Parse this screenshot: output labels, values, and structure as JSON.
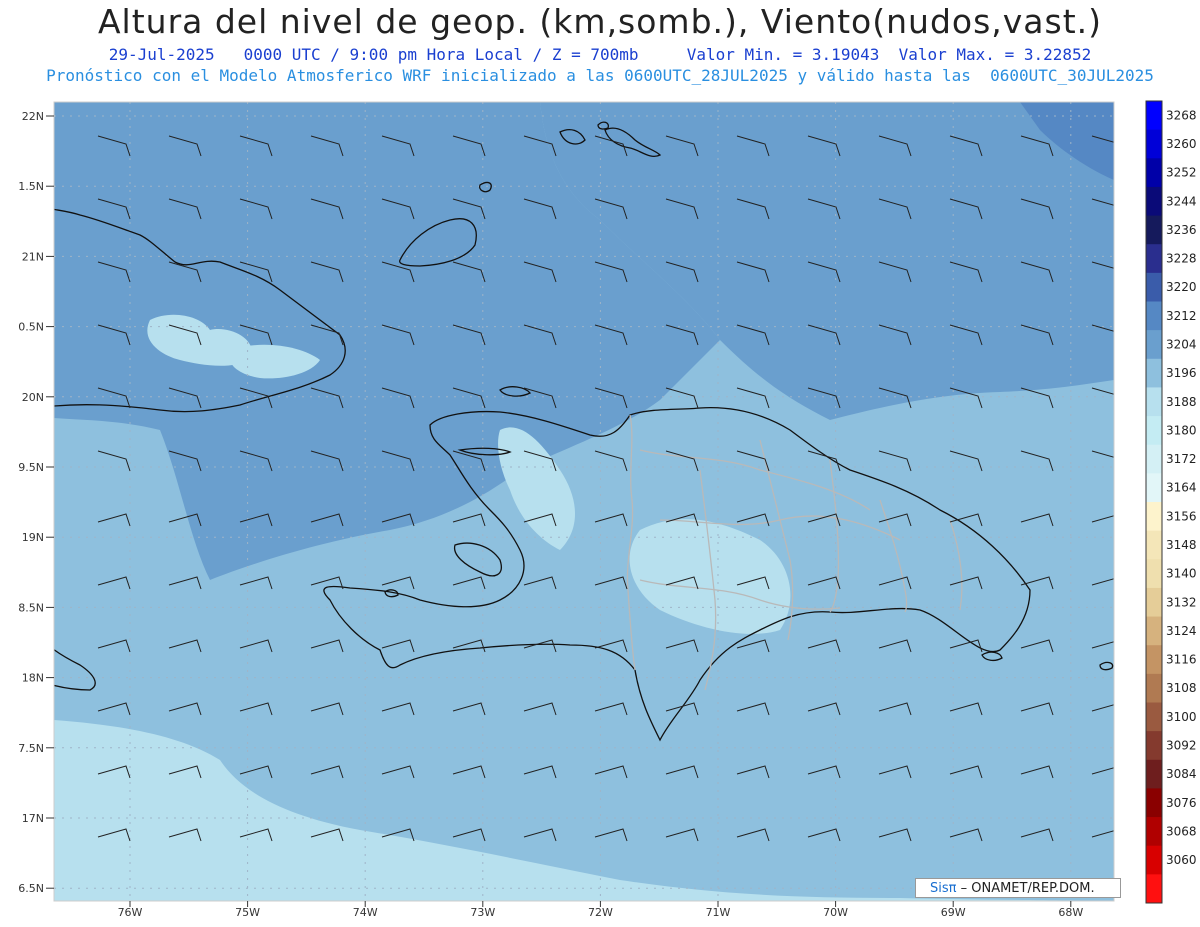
{
  "header": {
    "title": "Altura del nivel de geop. (km,somb.), Viento(nudos,vast.)",
    "subtitle1": "29-Jul-2025   0000 UTC / 9:00 pm Hora Local / Z = 700mb     Valor Min. = 3.19043  Valor Max. = 3.22852",
    "subtitle2": "Pronóstico con el Modelo Atmosferico WRF inicializado a las 0600UTC_28JUL2025 y válido hasta las  0600UTC_30JUL2025"
  },
  "map": {
    "lat_labels": [
      "22N",
      "1.5N",
      "21N",
      "0.5N",
      "20N",
      "9.5N",
      "19N",
      "8.5N",
      "18N",
      "7.5N",
      "17N",
      "6.5N"
    ],
    "lon_labels": [
      "76W",
      "75W",
      "74W",
      "73W",
      "72W",
      "71W",
      "70W",
      "69W",
      "68W"
    ],
    "fill_colors": {
      "c3204": "#b7e0ee",
      "c3212": "#8ec0de",
      "c3220": "#6a9fce",
      "c3228": "#5588c4"
    }
  },
  "colorbar": {
    "levels": [
      "3268",
      "3260",
      "3252",
      "3244",
      "3236",
      "3228",
      "3220",
      "3212",
      "3204",
      "3196",
      "3188",
      "3180",
      "3172",
      "3164",
      "3156",
      "3148",
      "3140",
      "3132",
      "3124",
      "3116",
      "3108",
      "3100",
      "3092",
      "3084",
      "3076",
      "3068",
      "3060"
    ],
    "colors": [
      "#0000ff",
      "#0000d8",
      "#0000a8",
      "#0a0a78",
      "#151a5c",
      "#2a2e8e",
      "#3a5caa",
      "#5588c4",
      "#6a9fce",
      "#8ec0de",
      "#b7e0ee",
      "#c4ecf3",
      "#d4f0f5",
      "#e2f6f8",
      "#fdf3cc",
      "#f4e6b8",
      "#efdfae",
      "#e5cd98",
      "#d6b27e",
      "#c49464",
      "#b07a52",
      "#9a5a40",
      "#843a2e",
      "#6e1e1e",
      "#8a0000",
      "#b00000",
      "#d80000",
      "#ff1010"
    ]
  },
  "credit": {
    "logo": "Sisπ",
    "text": "– ONAMET/REP.DOM."
  }
}
